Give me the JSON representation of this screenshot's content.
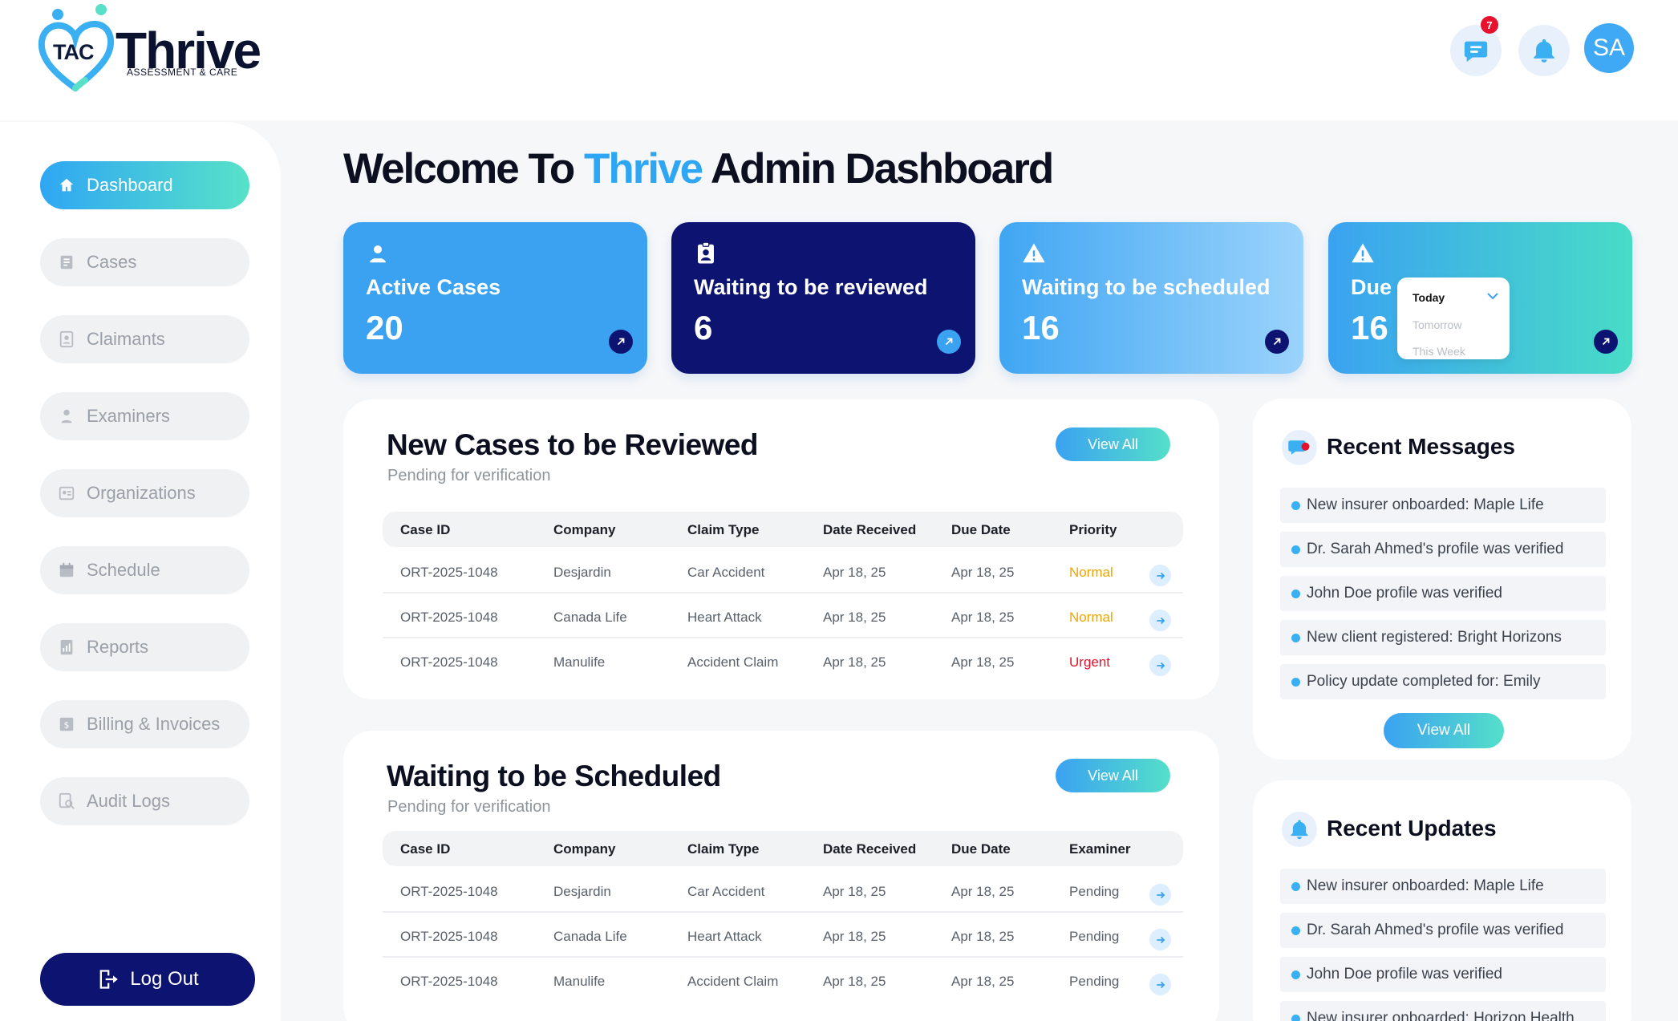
{
  "brand": {
    "short": "TAC",
    "name": "Thrive",
    "tagline": "ASSESSMENT & CARE"
  },
  "header": {
    "messages_badge": "7",
    "avatar_initials": "SA"
  },
  "sidebar": {
    "items": [
      {
        "label": "Dashboard",
        "icon": "home-icon",
        "active": true
      },
      {
        "label": "Cases",
        "icon": "cases-icon"
      },
      {
        "label": "Claimants",
        "icon": "claimants-icon"
      },
      {
        "label": "Examiners",
        "icon": "examiners-icon"
      },
      {
        "label": "Organizations",
        "icon": "organizations-icon"
      },
      {
        "label": "Schedule",
        "icon": "calendar-icon"
      },
      {
        "label": "Reports",
        "icon": "reports-icon"
      },
      {
        "label": "Billing & Invoices",
        "icon": "billing-icon"
      },
      {
        "label": "Audit Logs",
        "icon": "audit-logs-icon"
      }
    ],
    "logout_label": "Log Out"
  },
  "page_title": {
    "prefix": "Welcome To ",
    "accent": "Thrive",
    "suffix": " Admin Dashboard"
  },
  "stats": [
    {
      "label": "Active Cases",
      "value": "20",
      "icon": "user-icon"
    },
    {
      "label": "Waiting to be reviewed",
      "value": "6",
      "icon": "clipboard-user-icon"
    },
    {
      "label": "Waiting to be scheduled",
      "value": "16",
      "icon": "warning-icon"
    },
    {
      "label": "Due",
      "value": "16",
      "icon": "warning-icon",
      "dropdown": {
        "selected": "Today",
        "options": [
          "Today",
          "Tomorrow",
          "This Week"
        ]
      }
    }
  ],
  "new_cases": {
    "title": "New Cases to be Reviewed",
    "subtitle": "Pending for verification",
    "view_all": "View All",
    "columns": [
      "Case ID",
      "Company",
      "Claim Type",
      "Date Received",
      "Due Date",
      "Priority"
    ],
    "rows": [
      [
        "ORT-2025-1048",
        "Desjardin",
        "Car Accident",
        "Apr 18, 25",
        "Apr 18, 25",
        "Normal"
      ],
      [
        "ORT-2025-1048",
        "Canada Life",
        "Heart Attack",
        "Apr 18, 25",
        "Apr 18, 25",
        "Normal"
      ],
      [
        "ORT-2025-1048",
        "Manulife",
        "Accident Claim",
        "Apr 18, 25",
        "Apr 18, 25",
        "Urgent"
      ]
    ]
  },
  "scheduled": {
    "title": "Waiting to be Scheduled",
    "subtitle": "Pending for verification",
    "view_all": "View All",
    "columns": [
      "Case ID",
      "Company",
      "Claim Type",
      "Date Received",
      "Due Date",
      "Examiner"
    ],
    "rows": [
      [
        "ORT-2025-1048",
        "Desjardin",
        "Car Accident",
        "Apr 18, 25",
        "Apr 18, 25",
        "Pending"
      ],
      [
        "ORT-2025-1048",
        "Canada Life",
        "Heart Attack",
        "Apr 18, 25",
        "Apr 18, 25",
        "Pending"
      ],
      [
        "ORT-2025-1048",
        "Manulife",
        "Accident Claim",
        "Apr 18, 25",
        "Apr 18, 25",
        "Pending"
      ]
    ]
  },
  "recent_messages": {
    "title": "Recent Messages",
    "items": [
      "New insurer onboarded: Maple Life",
      "Dr. Sarah Ahmed's profile was verified",
      "John Doe profile was verified",
      "New client registered: Bright Horizons",
      "Policy update completed for: Emily"
    ],
    "view_all": "View All"
  },
  "recent_updates": {
    "title": "Recent Updates",
    "items": [
      "New insurer onboarded: Maple Life",
      "Dr. Sarah Ahmed's profile was verified",
      "John Doe profile was verified",
      "New insurer onboarded: Horizon Health"
    ]
  },
  "colors": {
    "primary": "#3aa2f1",
    "navy": "#0d1370",
    "teal": "#55dfc9",
    "urgent": "#e8112d",
    "normal": "#f0a500"
  }
}
